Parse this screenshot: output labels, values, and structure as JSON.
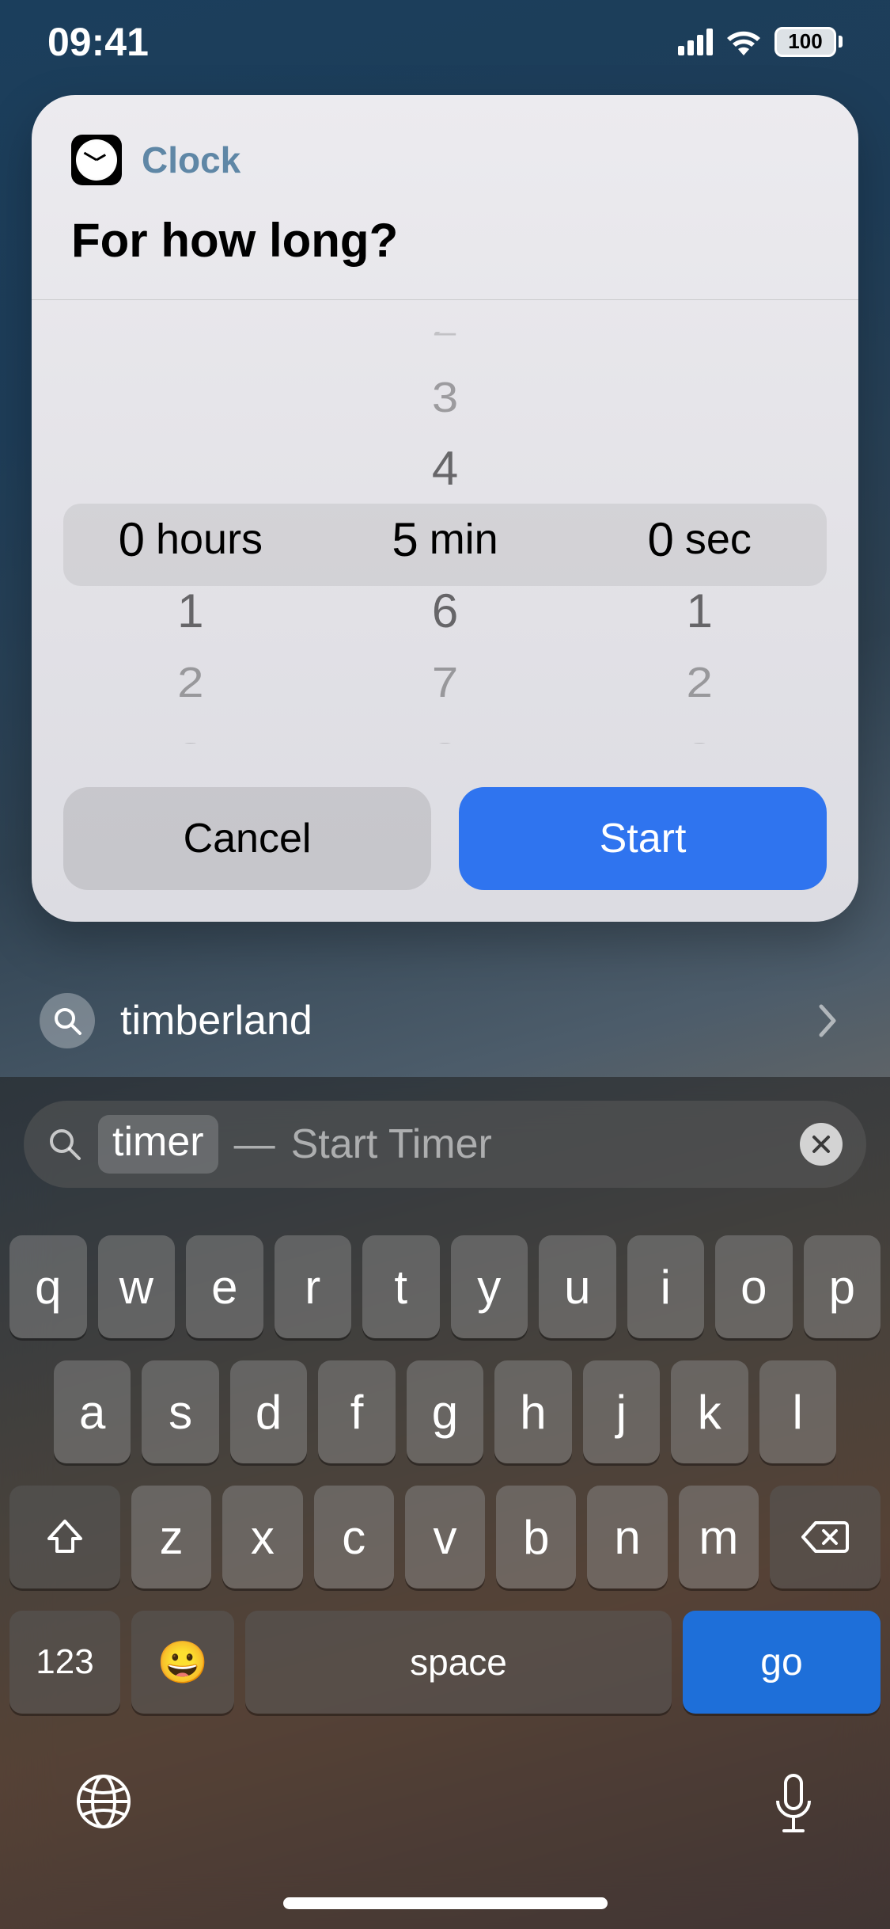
{
  "status": {
    "time": "09:41",
    "battery": "100"
  },
  "card": {
    "app_name": "Clock",
    "prompt": "For how long?",
    "cancel_label": "Cancel",
    "start_label": "Start",
    "picker": {
      "hours": {
        "selected": 0,
        "unit": "hours"
      },
      "minutes": {
        "selected": 5,
        "unit": "min"
      },
      "seconds": {
        "selected": 0,
        "unit": "sec"
      }
    }
  },
  "suggestion": {
    "text": "timberland"
  },
  "search": {
    "typed": "timer",
    "hint": "Start Timer"
  },
  "keyboard": {
    "row1": [
      "q",
      "w",
      "e",
      "r",
      "t",
      "y",
      "u",
      "i",
      "o",
      "p"
    ],
    "row2": [
      "a",
      "s",
      "d",
      "f",
      "g",
      "h",
      "j",
      "k",
      "l"
    ],
    "row3": [
      "z",
      "x",
      "c",
      "v",
      "b",
      "n",
      "m"
    ],
    "num_label": "123",
    "space_label": "space",
    "go_label": "go"
  }
}
